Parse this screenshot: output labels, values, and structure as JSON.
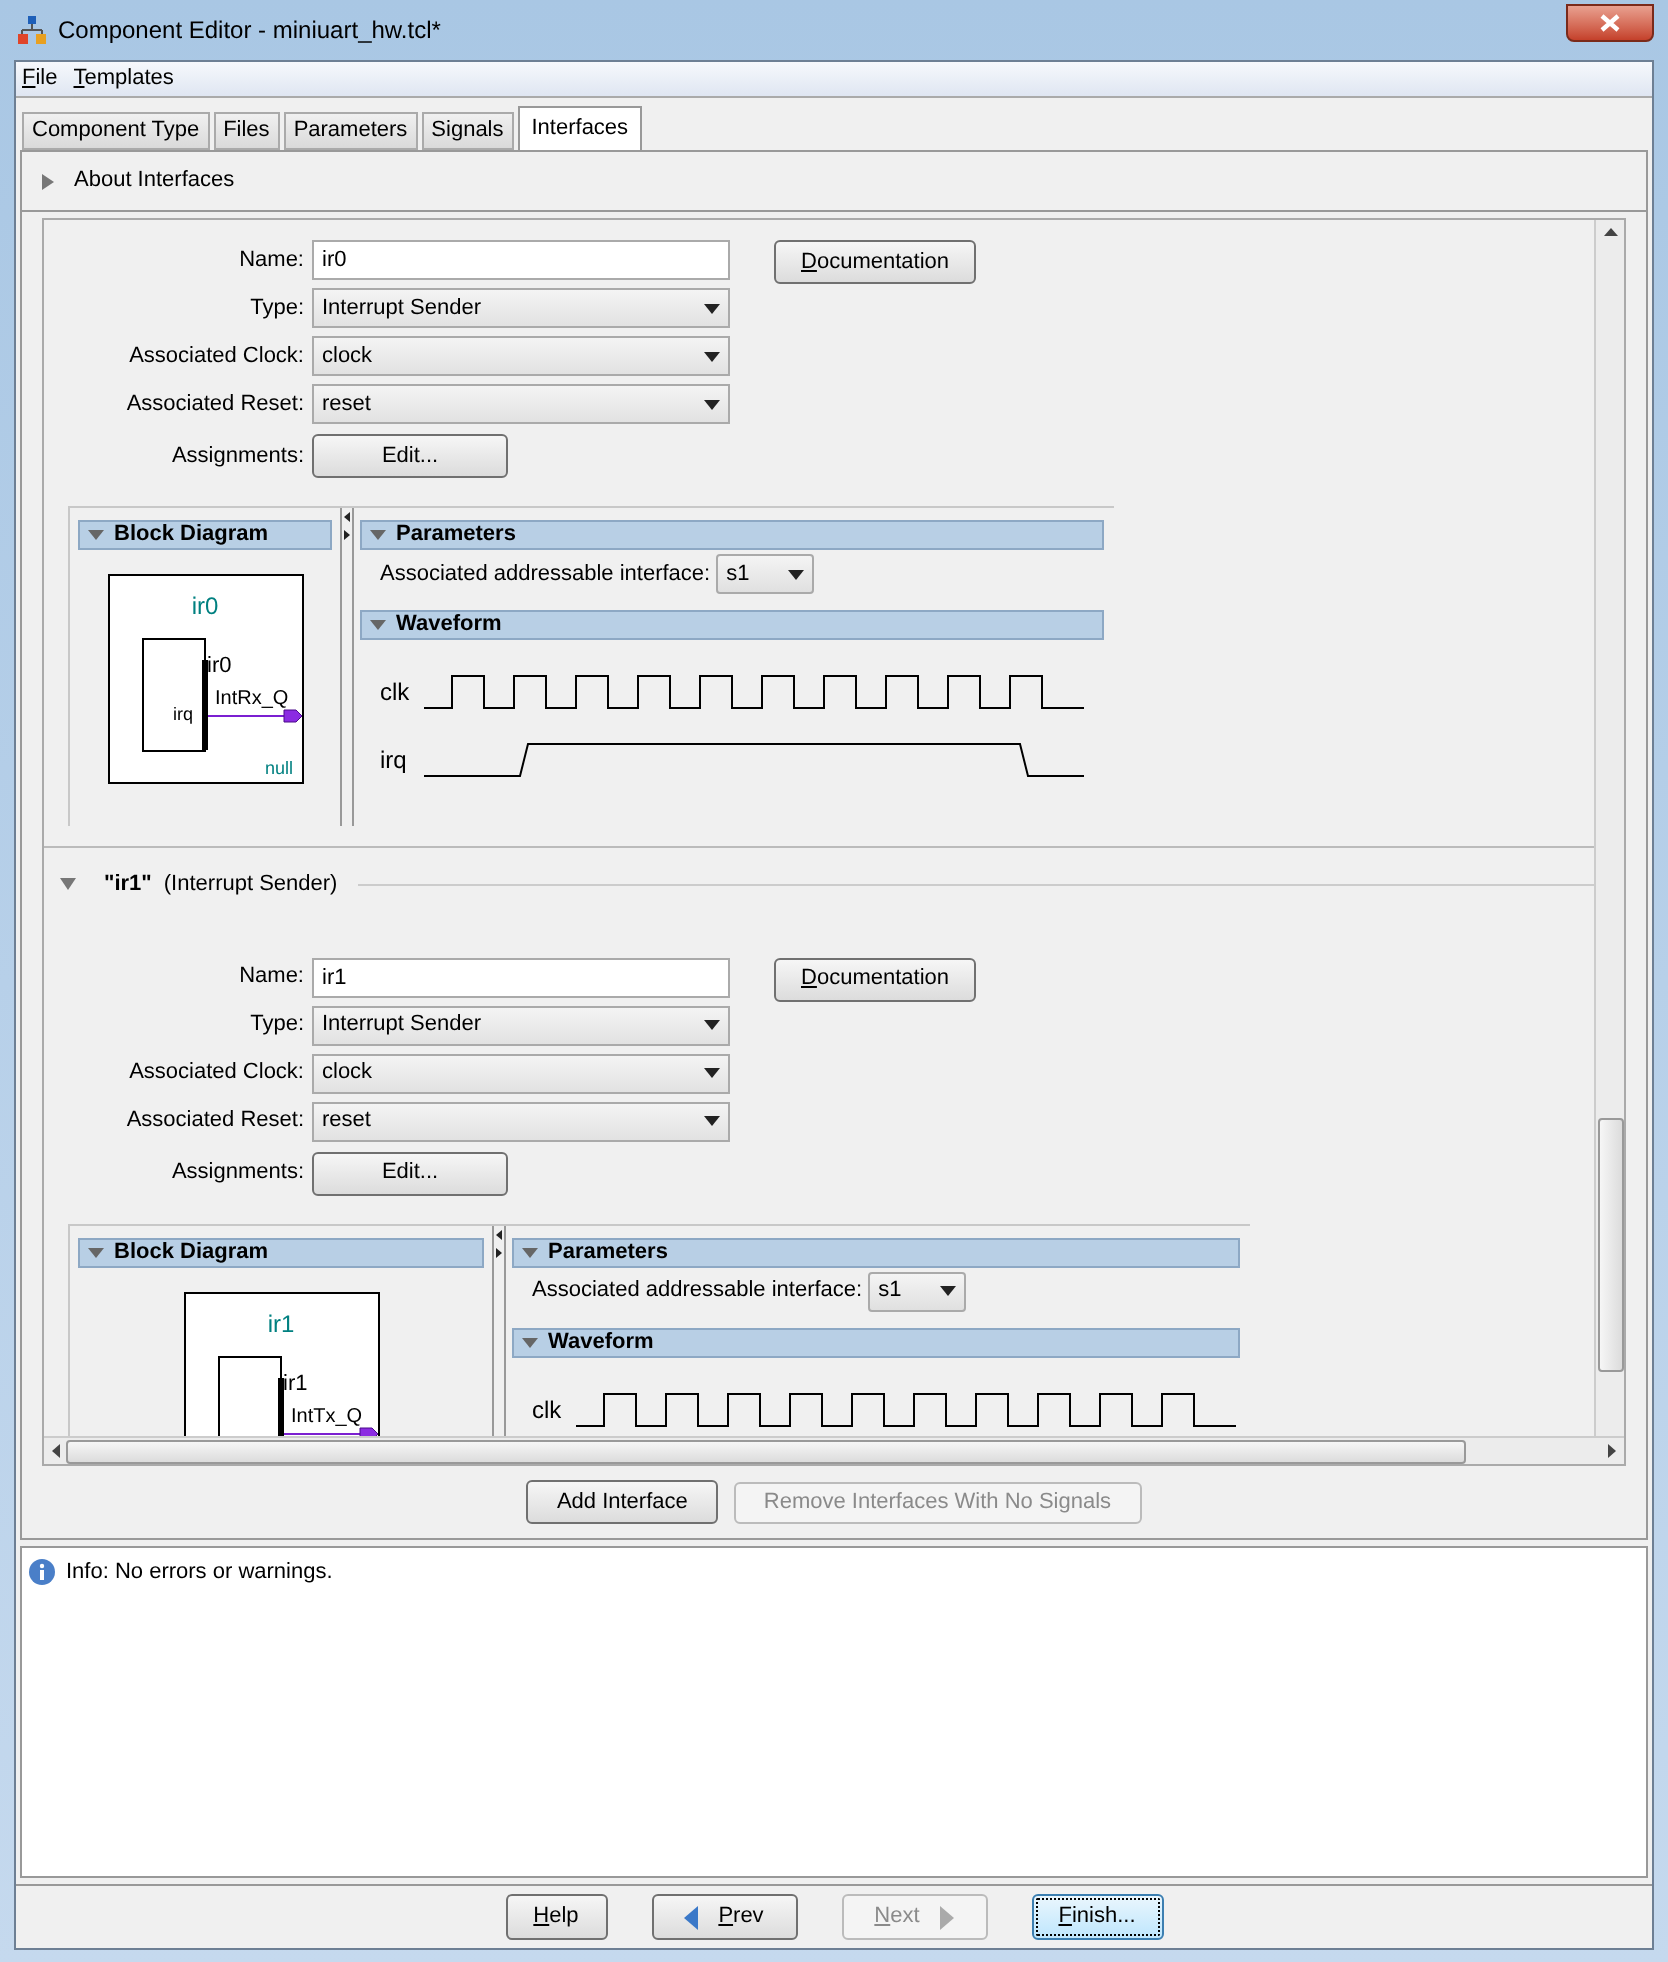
{
  "window": {
    "title": "Component Editor - miniuart_hw.tcl*"
  },
  "menu": [
    "File",
    "Templates"
  ],
  "tabs": [
    {
      "label": "Component Type",
      "selected": false
    },
    {
      "label": "Files",
      "selected": false
    },
    {
      "label": "Parameters",
      "selected": false
    },
    {
      "label": "Signals",
      "selected": false
    },
    {
      "label": "Interfaces",
      "selected": true
    }
  ],
  "about": {
    "label": "About Interfaces",
    "expanded": false
  },
  "interfaces": [
    {
      "fields": [
        {
          "label": "Name:",
          "value": "ir0",
          "kind": "text"
        },
        {
          "label": "Type:",
          "value": "Interrupt Sender",
          "kind": "select"
        },
        {
          "label": "Associated Clock:",
          "value": "clock",
          "kind": "select"
        },
        {
          "label": "Associated Reset:",
          "value": "reset",
          "kind": "select"
        },
        {
          "label": "Assignments:",
          "value": "Edit...",
          "kind": "button"
        }
      ],
      "documentation_button": "Documentation",
      "block_diagram": {
        "title": "Block Diagram",
        "instance": "ir0",
        "module_label": "ir0",
        "port_label": "IntRx_Q",
        "signal_label": "irq",
        "note": "null"
      },
      "parameters": {
        "title": "Parameters",
        "label": "Associated addressable interface:",
        "value": "s1"
      },
      "waveform": {
        "title": "Waveform",
        "signals": [
          {
            "name": "clk",
            "kind": "clock"
          },
          {
            "name": "irq",
            "kind": "pulse"
          }
        ]
      }
    },
    {
      "header": {
        "name": "\"ir1\"",
        "type": "(Interrupt Sender)",
        "expanded": true
      },
      "fields": [
        {
          "label": "Name:",
          "value": "ir1",
          "kind": "text"
        },
        {
          "label": "Type:",
          "value": "Interrupt Sender",
          "kind": "select"
        },
        {
          "label": "Associated Clock:",
          "value": "clock",
          "kind": "select"
        },
        {
          "label": "Associated Reset:",
          "value": "reset",
          "kind": "select"
        },
        {
          "label": "Assignments:",
          "value": "Edit...",
          "kind": "button"
        }
      ],
      "documentation_button": "Documentation",
      "block_diagram": {
        "title": "Block Diagram",
        "instance": "ir1",
        "module_label": "ir1",
        "port_label": "IntTx_Q"
      },
      "parameters": {
        "title": "Parameters",
        "label": "Associated addressable interface:",
        "value": "s1"
      },
      "waveform": {
        "title": "Waveform",
        "signals": [
          {
            "name": "clk",
            "kind": "clock"
          }
        ]
      }
    }
  ],
  "actions": [
    {
      "label": "Add Interface",
      "disabled": false
    },
    {
      "label": "Remove Interfaces With No Signals",
      "disabled": true
    }
  ],
  "messages": [
    {
      "kind": "info",
      "text": "Info: No errors or warnings."
    }
  ],
  "footer_buttons": [
    {
      "label": "Help",
      "disabled": false,
      "focused": false,
      "kind": "plain"
    },
    {
      "label": "Prev",
      "disabled": false,
      "focused": false,
      "kind": "back"
    },
    {
      "label": "Next",
      "disabled": true,
      "focused": false,
      "kind": "forward"
    },
    {
      "label": "Finish...",
      "disabled": false,
      "focused": true,
      "kind": "plain"
    }
  ]
}
